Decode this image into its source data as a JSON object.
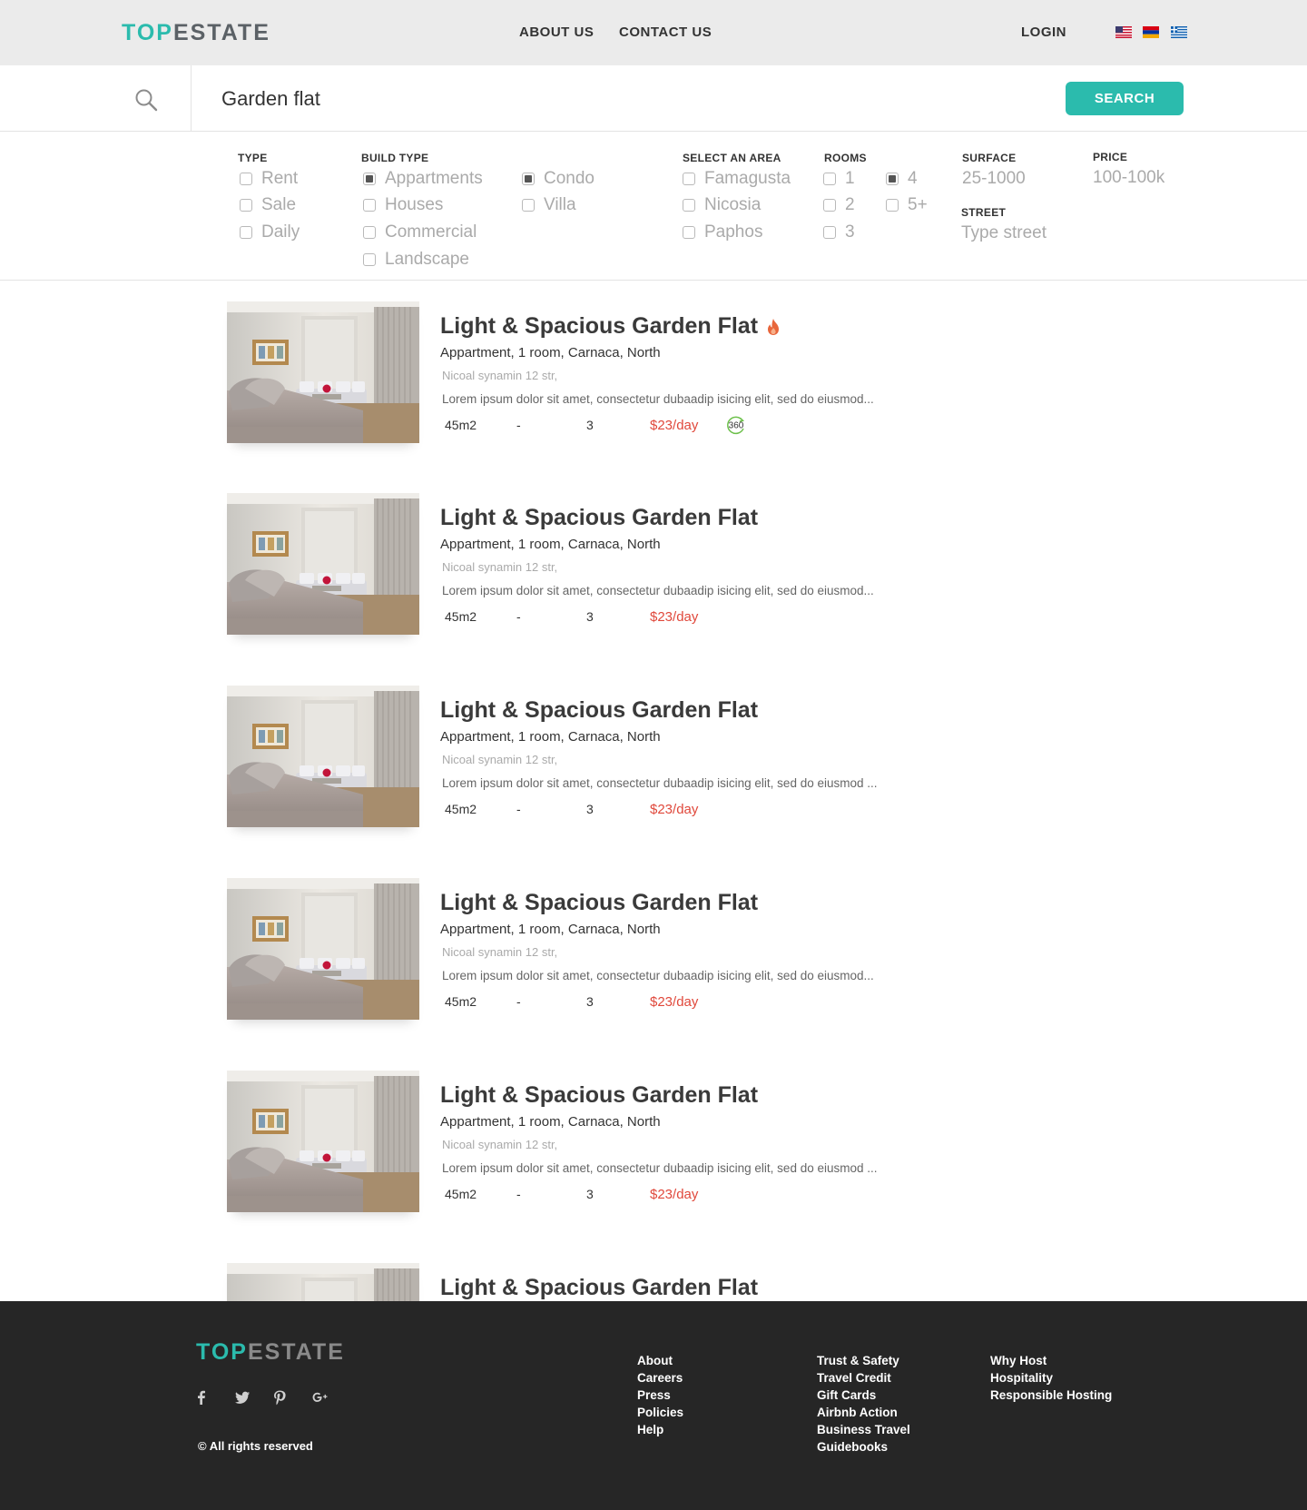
{
  "header": {
    "logo_part1": "TOP",
    "logo_part2": "ESTATE",
    "nav": [
      "ABOUT US",
      "CONTACT US"
    ],
    "login": "LOGIN",
    "flags": [
      "us-flag-icon",
      "armenia-flag-icon",
      "greece-flag-icon"
    ]
  },
  "search": {
    "value": "Garden flat",
    "button": "SEARCH"
  },
  "filters": {
    "type": {
      "label": "TYPE",
      "options": [
        {
          "label": "Rent",
          "checked": false
        },
        {
          "label": "Sale",
          "checked": false
        },
        {
          "label": "Daily",
          "checked": false
        }
      ]
    },
    "build_type": {
      "label": "BUILD TYPE",
      "options": [
        {
          "label": "Appartments",
          "checked": true
        },
        {
          "label": "Houses",
          "checked": false
        },
        {
          "label": "Commercial",
          "checked": false
        },
        {
          "label": "Landscape",
          "checked": false
        },
        {
          "label": "Condo",
          "checked": true
        },
        {
          "label": "Villa",
          "checked": false
        }
      ]
    },
    "area": {
      "label": "SELECT AN AREA",
      "options": [
        {
          "label": "Famagusta",
          "checked": false
        },
        {
          "label": "Nicosia",
          "checked": false
        },
        {
          "label": "Paphos",
          "checked": false
        }
      ]
    },
    "rooms": {
      "label": "ROOMS",
      "options": [
        {
          "label": "1",
          "checked": false
        },
        {
          "label": "2",
          "checked": false
        },
        {
          "label": "3",
          "checked": false
        },
        {
          "label": "4",
          "checked": true
        },
        {
          "label": "5+",
          "checked": false
        }
      ]
    },
    "surface": {
      "label": "SURFACE",
      "value": "25-1000"
    },
    "price": {
      "label": "PRICE",
      "value": "100-100k"
    },
    "street": {
      "label": "STREET",
      "placeholder": "Type street"
    }
  },
  "listings": [
    {
      "title": "Light & Spacious Garden Flat",
      "hot": true,
      "subtitle": "Appartment, 1 room, Carnaca, North",
      "address": "Nicoal synamin 12 str,",
      "description": "Lorem ipsum dolor sit amet, consectetur  dubaadip isicing elit, sed do eiusmod...",
      "area": "45m2",
      "floor": "-",
      "rooms": "3",
      "price": "$23/day",
      "tour360": "360"
    },
    {
      "title": "Light & Spacious Garden Flat",
      "hot": false,
      "subtitle": "Appartment, 1 room, Carnaca, North",
      "address": "Nicoal synamin 12 str,",
      "description": "Lorem ipsum dolor sit amet, consectetur  dubaadip isicing elit, sed do eiusmod...",
      "area": "45m2",
      "floor": "-",
      "rooms": "3",
      "price": "$23/day"
    },
    {
      "title": "Light & Spacious Garden Flat",
      "hot": false,
      "subtitle": "Appartment, 1 room, Carnaca, North",
      "address": "Nicoal synamin 12 str,",
      "description": "Lorem ipsum dolor sit amet, consectetur  dubaadip isicing elit, sed do eiusmod ...",
      "area": "45m2",
      "floor": "-",
      "rooms": "3",
      "price": "$23/day"
    },
    {
      "title": "Light & Spacious Garden Flat",
      "hot": false,
      "subtitle": "Appartment, 1 room, Carnaca, North",
      "address": "Nicoal synamin 12 str,",
      "description": "Lorem ipsum dolor sit amet, consectetur  dubaadip isicing elit, sed do eiusmod...",
      "area": "45m2",
      "floor": "-",
      "rooms": "3",
      "price": "$23/day"
    },
    {
      "title": "Light & Spacious Garden Flat",
      "hot": false,
      "subtitle": "Appartment, 1 room, Carnaca, North",
      "address": "Nicoal synamin 12 str,",
      "description": "Lorem ipsum dolor sit amet, consectetur  dubaadip isicing elit, sed do eiusmod ...",
      "area": "45m2",
      "floor": "-",
      "rooms": "3",
      "price": "$23/day"
    },
    {
      "title": "Light & Spacious Garden Flat"
    }
  ],
  "footer": {
    "logo_part1": "TOP",
    "logo_part2": "ESTATE",
    "social": [
      "facebook-icon",
      "twitter-icon",
      "pinterest-icon",
      "google-plus-icon"
    ],
    "copyright": "© All rights reserved",
    "col1": [
      "About",
      "Careers",
      "Press",
      "Policies",
      "Help"
    ],
    "col2": [
      "Trust & Safety",
      "Travel Credit",
      "Gift Cards",
      "Airbnb Action",
      "Business Travel",
      "Guidebooks"
    ],
    "col3": [
      "Why Host",
      "Hospitality",
      "Responsible Hosting"
    ]
  },
  "colors": {
    "accent": "#2bbbad",
    "price": "#e0483b",
    "header_bg": "#ebebeb",
    "footer_bg": "#262626"
  }
}
